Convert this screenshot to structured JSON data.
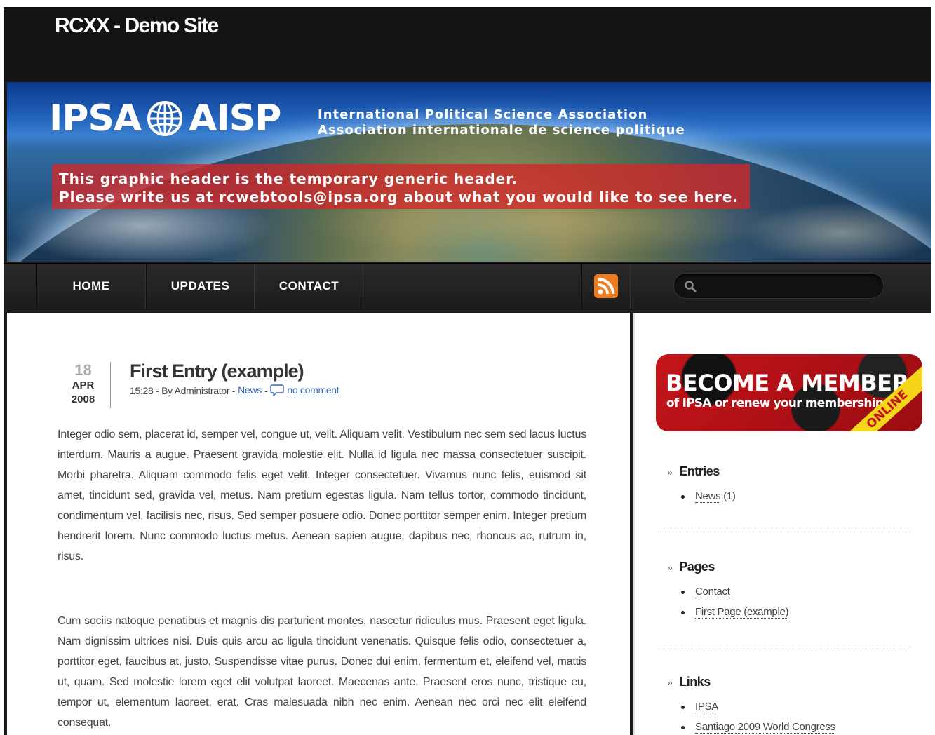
{
  "site": {
    "title": "RCXX - Demo Site"
  },
  "banner": {
    "logo_left": "IPSA",
    "logo_right": "AISP",
    "assoc_en": "International Political Science Association",
    "assoc_fr": "Association internationale de science politique",
    "notice_line1": "This graphic header is the temporary generic header.",
    "notice_line2": "Please write us at rcwebtools@ipsa.org about what you would like to see here."
  },
  "nav": {
    "items": [
      {
        "label": "HOME"
      },
      {
        "label": "UPDATES"
      },
      {
        "label": "CONTACT"
      }
    ],
    "rss_icon": "rss-icon",
    "search": {
      "value": "",
      "placeholder": ""
    }
  },
  "post": {
    "day": "18",
    "month": "APR",
    "year": "2008",
    "title": "First Entry (example)",
    "time_author": "15:28 - By Administrator -",
    "category": "News",
    "sep": "-",
    "comments": "no comment",
    "paragraph1": "Integer odio sem, placerat id, semper vel, congue ut, velit. Aliquam velit. Vestibulum nec sem sed lacus luctus interdum. Mauris a augue. Praesent gravida molestie elit. Nulla id ligula nec massa consectetuer suscipit. Morbi pharetra. Aliquam commodo felis eget velit. Integer consectetuer. Vivamus nunc felis, euismod sit amet, tincidunt sed, gravida vel, metus. Nam pretium egestas ligula. Nam tellus tortor, commodo tincidunt, condimentum vel, facilisis nec, risus. Sed semper posuere odio. Donec porttitor semper enim. Integer pretium hendrerit lorem. Nunc commodo luctus metus. Aenean sapien augue, dapibus nec, rhoncus ac, rutrum in, risus.",
    "paragraph2": "Cum sociis natoque penatibus et magnis dis parturient montes, nascetur ridiculus mus. Praesent eget ligula. Nam dignissim ultrices nisi. Duis quis arcu ac ligula tincidunt venenatis. Quisque felis odio, consectetuer a, porttitor eget, faucibus at, justo. Suspendisse vitae purus. Donec dui enim, fermentum et, eleifend vel, mattis ut, quam. Sed molestie lorem eget elit volutpat laoreet. Maecenas ante. Praesent eros nunc, tristique eu, tempor ut, elementum laoreet, erat. Cras malesuada nibh nec enim. Aenean nec orci nec elit eleifend consequat."
  },
  "sidebar": {
    "member_banner": {
      "headline": "BECOME A MEMBER",
      "subline": "of IPSA or renew your membership",
      "ribbon": "ONLINE"
    },
    "entries": {
      "title": "Entries",
      "items": [
        {
          "label": "News",
          "count": "(1)"
        }
      ]
    },
    "pages": {
      "title": "Pages",
      "items": [
        {
          "label": "Contact"
        },
        {
          "label": "First Page (example)"
        }
      ]
    },
    "links": {
      "title": "Links",
      "items": [
        {
          "label": "IPSA"
        },
        {
          "label": "Santiago 2009 World Congress"
        }
      ]
    },
    "raquo": "»"
  },
  "colors": {
    "accent_link": "#3366bb",
    "notice_bg": "#d22828",
    "nav_bg": "#1b1b1b",
    "rss": "#e4670c"
  }
}
